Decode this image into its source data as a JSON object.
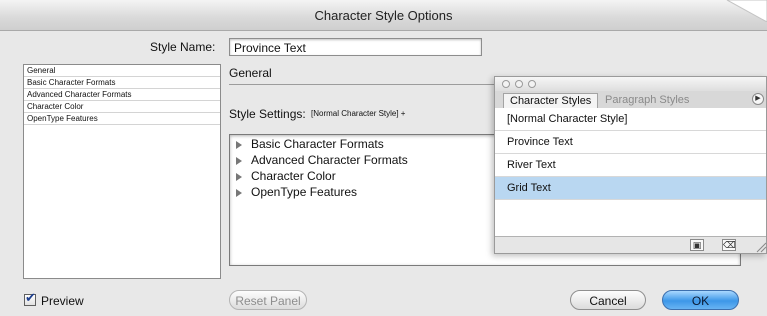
{
  "window": {
    "title": "Character Style Options"
  },
  "style_name": {
    "label": "Style Name:",
    "value": "Province Text"
  },
  "sidebar": {
    "items": [
      {
        "label": "General"
      },
      {
        "label": "Basic Character Formats"
      },
      {
        "label": "Advanced Character Formats"
      },
      {
        "label": "Character Color"
      },
      {
        "label": "OpenType Features"
      }
    ]
  },
  "section": {
    "title": "General"
  },
  "style_settings": {
    "label": "Style Settings:",
    "value": "[Normal Character Style] +"
  },
  "settings_tree": {
    "rows": [
      {
        "label": "Basic Character Formats"
      },
      {
        "label": "Advanced Character Formats"
      },
      {
        "label": "Character Color"
      },
      {
        "label": "OpenType Features"
      }
    ]
  },
  "panel": {
    "tabs": {
      "active": "Character Styles",
      "inactive": "Paragraph Styles"
    },
    "menu_icon": "panel-menu-icon",
    "styles": [
      {
        "label": "[Normal Character Style]"
      },
      {
        "label": "Province Text"
      },
      {
        "label": "River Text"
      },
      {
        "label": "Grid Text",
        "selected": true
      }
    ],
    "footer_icons": [
      "new-style-icon",
      "trash-icon"
    ]
  },
  "footer": {
    "preview_label": "Preview",
    "preview_checked": true,
    "reset_label": "Reset Panel",
    "cancel_label": "Cancel",
    "ok_label": "OK"
  },
  "colors": {
    "selection": "#b9d7f1",
    "ok_button": "#3d97e8"
  }
}
